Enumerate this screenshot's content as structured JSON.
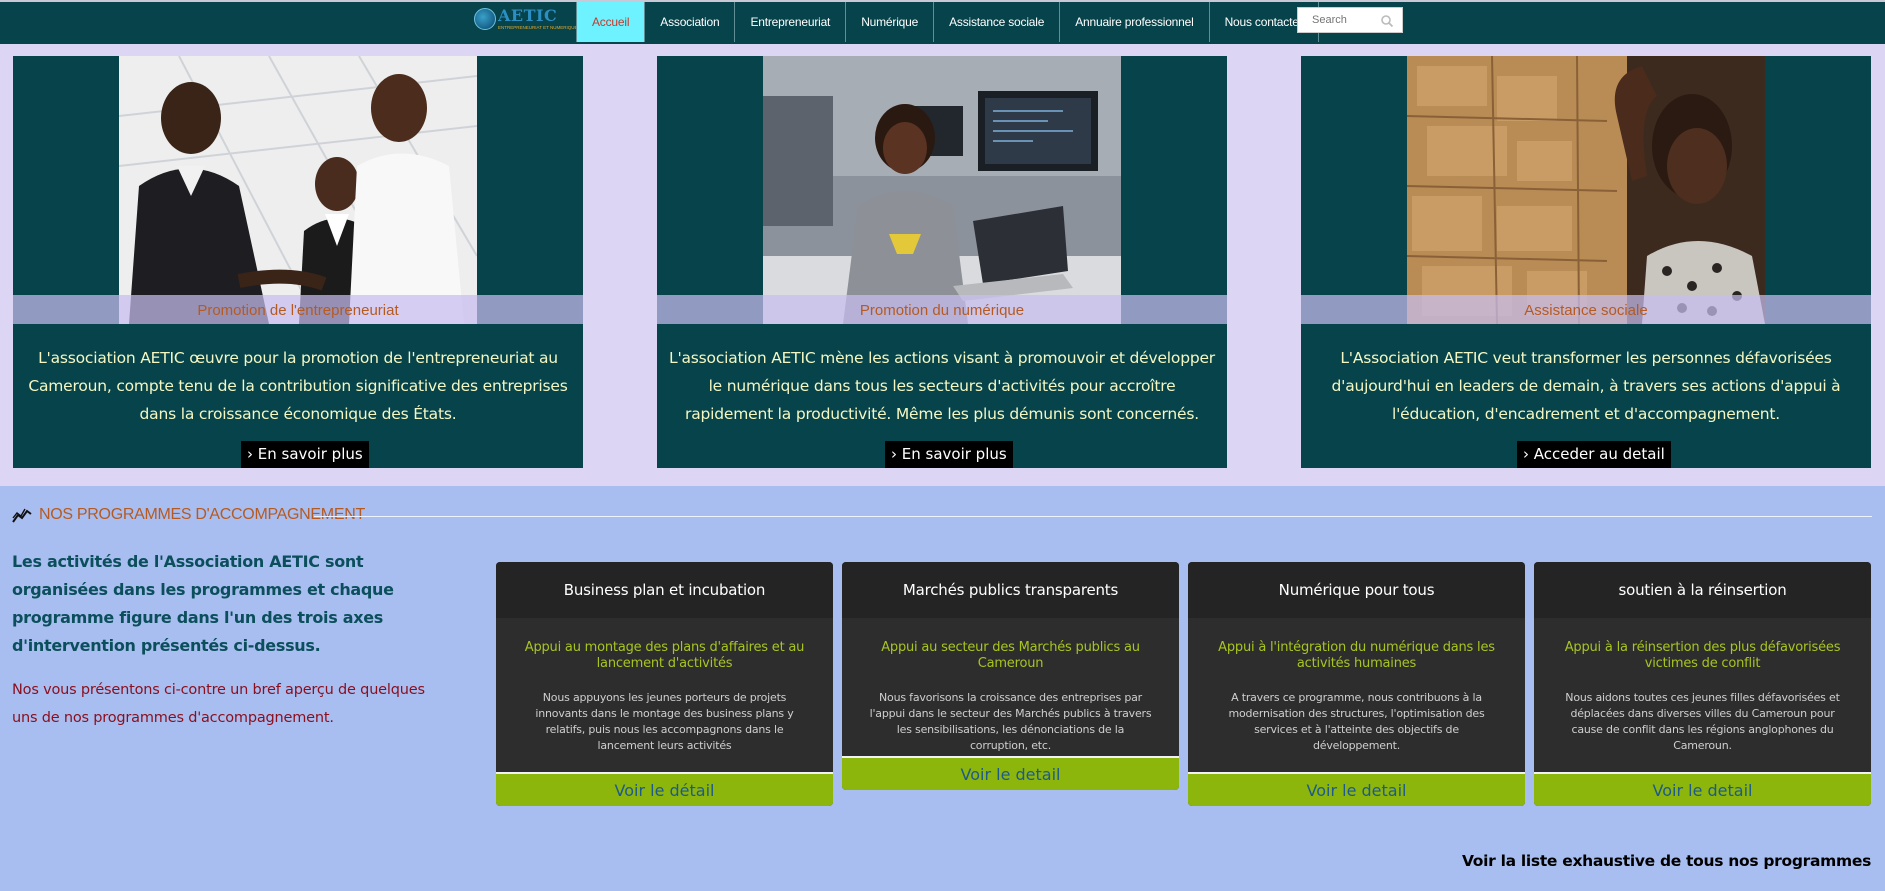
{
  "nav": {
    "logo_name": "AETIC",
    "logo_tagline": "ENTREPRENEURIAT ET NUMERIQUE",
    "items": [
      {
        "label": "Accueil"
      },
      {
        "label": "Association"
      },
      {
        "label": "Entrepreneuriat"
      },
      {
        "label": "Numérique"
      },
      {
        "label": "Assistance sociale"
      },
      {
        "label": "Annuaire professionnel"
      },
      {
        "label": "Nous contacter"
      }
    ],
    "search_placeholder": "Search"
  },
  "cards": [
    {
      "caption": "Promotion de l'entrepreneuriat",
      "description": "L'association AETIC œuvre pour la promotion de l'entrepreneuriat au Cameroun, compte tenu de la contribution significative des entreprises dans la croissance économique des États.",
      "button": "› En savoir plus"
    },
    {
      "caption": "Promotion du numérique",
      "description": "L'association AETIC  mène les actions visant à promouvoir et développer le numérique dans tous les secteurs d'activités pour accroître rapidement la productivité. Même les plus démunis sont concernés.",
      "button": "› En savoir plus"
    },
    {
      "caption": "Assistance sociale",
      "description": "L'Association AETIC veut transformer les personnes défavorisées d'aujourd'hui en leaders de demain, à travers ses actions d'appui à l'éducation, d'encadrement et d'accompagnement.",
      "button": "› Acceder au detail"
    }
  ],
  "programs_section": {
    "title": "NOS PROGRAMMES D'ACCOMPAGNEMENT",
    "intro_bold": "Les activités de l'Association AETIC sont organisées dans les programmes et chaque programme figure dans l'un des trois axes d'intervention présentés ci-dessus.",
    "intro": "Nos vous présentons ci-contre un bref aperçu de quelques uns de nos programmes d'accompagnement.",
    "programs": [
      {
        "title": "Business plan et incubation",
        "subtitle": "Appui au montage des plans d'affaires et au lancement d'activités",
        "text": "Nous appuyons les jeunes porteurs de projets innovants dans le montage des business plans y relatifs, puis nous les accompagnons dans le lancement leurs activités",
        "button": "Voir le détail"
      },
      {
        "title": "Marchés publics transparents",
        "subtitle": "Appui au secteur des Marchés publics au Cameroun",
        "text": "Nous favorisons la croissance des entreprises par l'appui dans le secteur des Marchés publics à travers les sensibilisations, les dénonciations de la corruption, etc.",
        "button": "Voir le detail"
      },
      {
        "title": "Numérique pour tous",
        "subtitle": "Appui à l'intégration du numérique dans les activités humaines",
        "text": "A travers ce programme, nous contribuons à la modernisation des structures, l'optimisation des services et à l'atteinte des objectifs de développement.",
        "button": "Voir le detail"
      },
      {
        "title": "soutien à la réinsertion",
        "subtitle": "Appui à la réinsertion des plus défavorisées victimes de conflit",
        "text": "Nous aidons toutes ces jeunes filles défavorisées et déplacées dans diverses villes du Cameroun pour cause de conflit dans les régions anglophones du Cameroun.",
        "button": "Voir le detail"
      }
    ],
    "all_link": "Voir la liste exhaustive de tous nos programmes"
  }
}
